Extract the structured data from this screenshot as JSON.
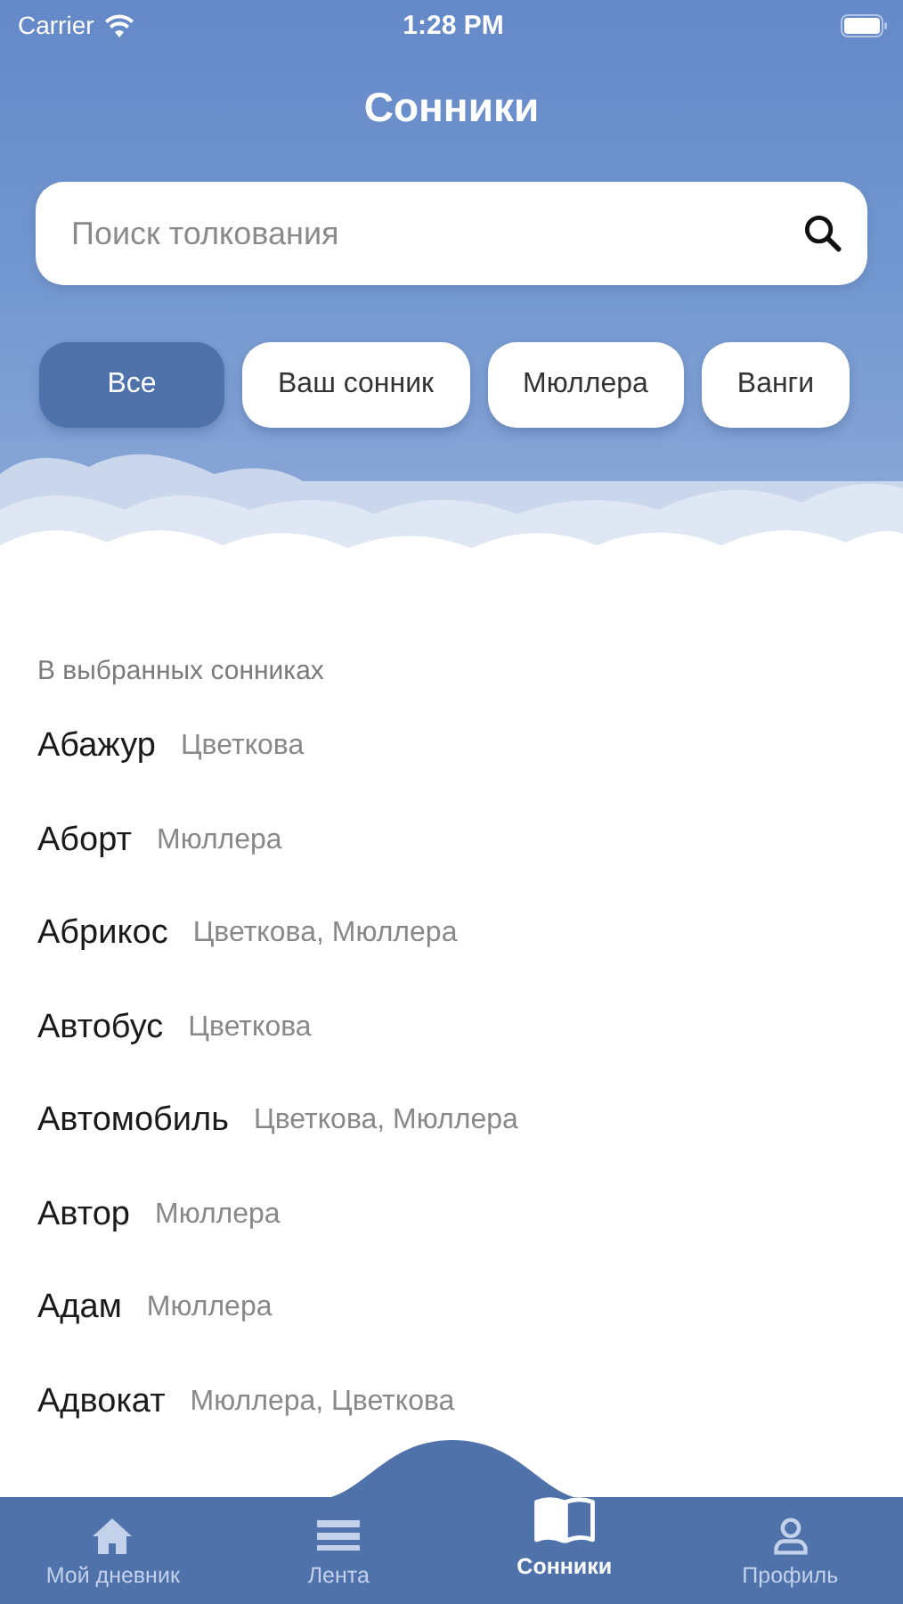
{
  "status_bar": {
    "carrier": "Carrier",
    "time": "1:28 PM"
  },
  "title": "Сонники",
  "search": {
    "placeholder": "Поиск толкования"
  },
  "filters": [
    {
      "label": "Все",
      "selected": true
    },
    {
      "label": "Ваш сонник",
      "selected": false
    },
    {
      "label": "Мюллера",
      "selected": false
    },
    {
      "label": "Ванги",
      "selected": false
    }
  ],
  "section_title": "В выбранных сонниках",
  "entries": [
    {
      "word": "Абажур",
      "sources": "Цветкова"
    },
    {
      "word": "Аборт",
      "sources": "Мюллера"
    },
    {
      "word": "Абрикос",
      "sources": "Цветкова, Мюллера"
    },
    {
      "word": "Автобус",
      "sources": "Цветкова"
    },
    {
      "word": "Автомобиль",
      "sources": "Цветкова, Мюллера"
    },
    {
      "word": "Автор",
      "sources": "Мюллера"
    },
    {
      "word": "Адам",
      "sources": "Мюллера"
    },
    {
      "word": "Адвокат",
      "sources": "Мюллера, Цветкова"
    }
  ],
  "tab_bar": [
    {
      "label": "Мой дневник",
      "kind": "home",
      "selected": false
    },
    {
      "label": "Лента",
      "kind": "feed",
      "selected": false
    },
    {
      "label": "Сонники",
      "kind": "book",
      "selected": true
    },
    {
      "label": "Профиль",
      "kind": "profile",
      "selected": false
    }
  ]
}
